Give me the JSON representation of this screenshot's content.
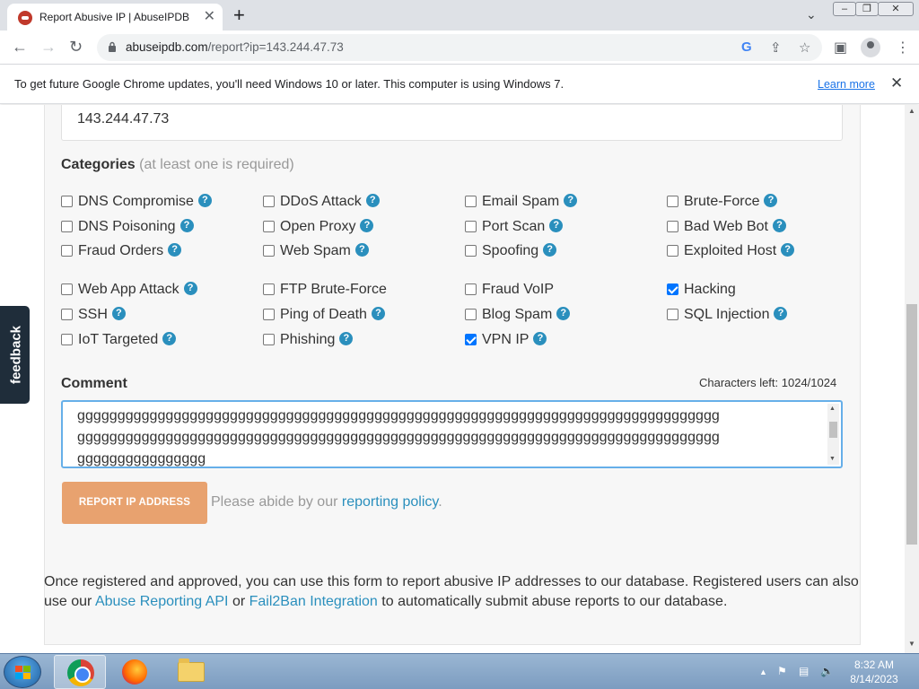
{
  "browser": {
    "tab_title": "Report Abusive IP | AbuseIPDB",
    "tab_close": "✕",
    "new_tab": "+",
    "url_host": "abuseipdb.com",
    "url_path": "/report?ip=143.244.47.73"
  },
  "infobar": {
    "message": "To get future Google Chrome updates, you'll need Windows 10 or later. This computer is using Windows 7.",
    "learn_more": "Learn more",
    "close": "✕"
  },
  "form": {
    "ip_value": "143.244.47.73",
    "categories_label": "Categories",
    "categories_hint": "(at least one is required)",
    "categories": [
      {
        "label": "DNS Compromise",
        "checked": false,
        "help": true
      },
      {
        "label": "DDoS Attack",
        "checked": false,
        "help": true
      },
      {
        "label": "Email Spam",
        "checked": false,
        "help": true
      },
      {
        "label": "Brute-Force",
        "checked": false,
        "help": true
      },
      {
        "label": "DNS Poisoning",
        "checked": false,
        "help": true
      },
      {
        "label": "Open Proxy",
        "checked": false,
        "help": true
      },
      {
        "label": "Port Scan",
        "checked": false,
        "help": true
      },
      {
        "label": "Bad Web Bot",
        "checked": false,
        "help": true
      },
      {
        "label": "Fraud Orders",
        "checked": false,
        "help": true
      },
      {
        "label": "Web Spam",
        "checked": false,
        "help": true
      },
      {
        "label": "Spoofing",
        "checked": false,
        "help": true
      },
      {
        "label": "Exploited Host",
        "checked": false,
        "help": true
      },
      {
        "label": "Web App Attack",
        "checked": false,
        "help": true
      },
      {
        "label": "FTP Brute-Force",
        "checked": false,
        "help": false
      },
      {
        "label": "Fraud VoIP",
        "checked": false,
        "help": false
      },
      {
        "label": "Hacking",
        "checked": true,
        "help": false
      },
      {
        "label": "SSH",
        "checked": false,
        "help": true
      },
      {
        "label": "Ping of Death",
        "checked": false,
        "help": true
      },
      {
        "label": "Blog Spam",
        "checked": false,
        "help": true
      },
      {
        "label": "SQL Injection",
        "checked": false,
        "help": true
      },
      {
        "label": "IoT Targeted",
        "checked": false,
        "help": true
      },
      {
        "label": "Phishing",
        "checked": false,
        "help": true
      },
      {
        "label": "VPN IP",
        "checked": true,
        "help": true
      }
    ],
    "comment_label": "Comment",
    "chars_left": "Characters left: 1024/1024",
    "comment_lines": [
      "gggggggggggggggggggggggggggggggggggggggggggggggggggggggggggggggggggggggggggggggg",
      "gggggggggggggggggggggggggggggggggggggggggggggggggggggggggggggggggggggggggggggggg",
      "gggggggggggggggg"
    ],
    "submit_label": "REPORT IP ADDRESS",
    "abide_text": "Please abide by our",
    "abide_link": "reporting policy",
    "abide_end": "."
  },
  "footer": {
    "text1": "Once registered and approved, you can use this form to report abusive IP addresses to our database. Registered users can also use our",
    "link1": "Abuse Reporting API",
    "text2": "or",
    "link2": "Fail2Ban Integration",
    "text3": "to automatically submit abuse reports to our database."
  },
  "feedback_tab": "feedback",
  "taskbar": {
    "time": "8:32 AM",
    "date": "8/14/2023"
  },
  "colors": {
    "link": "#2a8fbd",
    "submit_button": "#e8a26f",
    "checkbox_checked": "#0075ff"
  }
}
